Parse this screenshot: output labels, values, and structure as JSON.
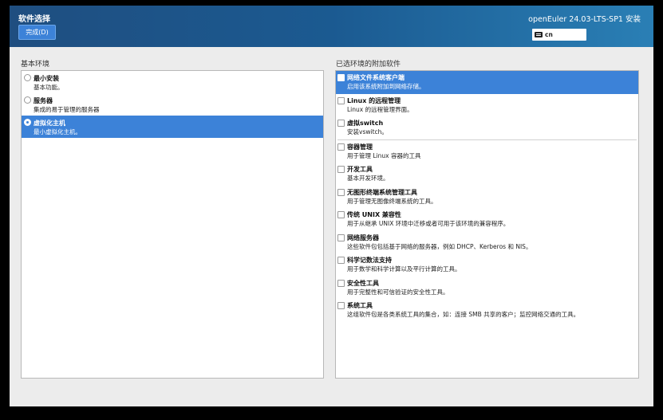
{
  "header": {
    "title": "软件选择",
    "done_label": "完成(D)",
    "install_title": "openEuler 24.03-LTS-SP1 安装",
    "keyboard_layout": "cn"
  },
  "base_environment": {
    "heading": "基本环境",
    "items": [
      {
        "name": "最小安装",
        "desc": "基本功能。",
        "selected": false
      },
      {
        "name": "服务器",
        "desc": "集成的易于管理的服务器",
        "selected": false
      },
      {
        "name": "虚拟化主机",
        "desc": "最小虚拟化主机。",
        "selected": true
      }
    ]
  },
  "addons": {
    "heading": "已选环境的附加软件",
    "items": [
      {
        "name": "网络文件系统客户端",
        "desc": "启用该系统附加到网络存储。",
        "checked": false,
        "highlighted": true
      },
      {
        "name": "Linux 的远程管理",
        "desc": "Linux 的远程管理界面。",
        "checked": false,
        "highlighted": false
      },
      {
        "name": "虚拟switch",
        "desc": "安装vswitch。",
        "checked": false,
        "highlighted": false
      },
      {
        "name": "容器管理",
        "desc": "用于管理 Linux 容器的工具",
        "checked": false,
        "highlighted": false
      },
      {
        "name": "开发工具",
        "desc": "基本开发环境。",
        "checked": false,
        "highlighted": false
      },
      {
        "name": "无图形终端系统管理工具",
        "desc": "用于管理无图像终端系统的工具。",
        "checked": false,
        "highlighted": false
      },
      {
        "name": "传统 UNIX 兼容性",
        "desc": "用于从继承 UNIX 环境中迁移或者可用于该环境的兼容程序。",
        "checked": false,
        "highlighted": false
      },
      {
        "name": "网络服务器",
        "desc": "这些软件包包括基于网络的服务器，例如 DHCP、Kerberos 和 NIS。",
        "checked": false,
        "highlighted": false
      },
      {
        "name": "科学记数法支持",
        "desc": "用于数学和科学计算以及平行计算的工具。",
        "checked": false,
        "highlighted": false
      },
      {
        "name": "安全性工具",
        "desc": "用于完整性和可信验证的安全性工具。",
        "checked": false,
        "highlighted": false
      },
      {
        "name": "系统工具",
        "desc": "这组软件包是各类系统工具的集合，如：连接 SMB 共享的客户；监控网络交通的工具。",
        "checked": false,
        "highlighted": false
      }
    ]
  }
}
